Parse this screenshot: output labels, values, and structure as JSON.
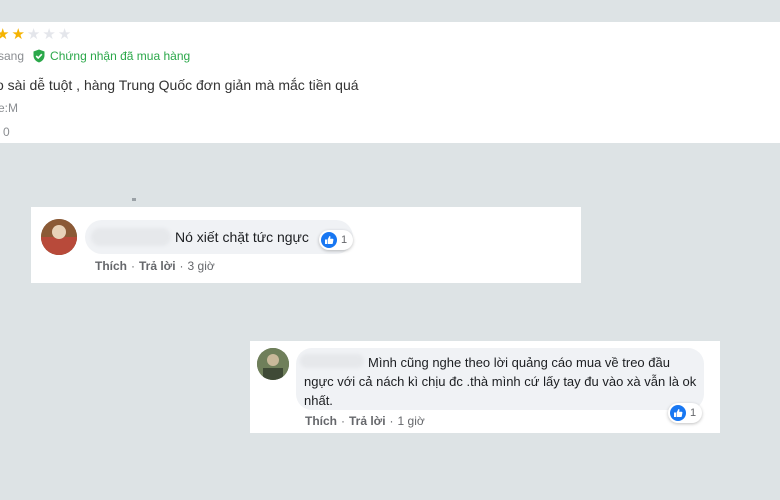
{
  "review": {
    "stars": {
      "filled": 2,
      "total": 5
    },
    "reviewer_partial": "sang",
    "verified_label": "Chứng nhận đã mua hàng",
    "text": "o sài dễ tuột , hàng Trung Quốc đơn giản mà mắc tiền quá",
    "variant": "e:M",
    "likes": "0",
    "colors": {
      "star": "#f5b301",
      "verified": "#2ba84a"
    }
  },
  "comments": [
    {
      "text": "Nó xiết chặt tức ngực",
      "reaction_count": "1",
      "actions": {
        "like": "Thích",
        "reply": "Trả lời",
        "time": "3 giờ"
      }
    },
    {
      "lines": [
        "Mình cũng nghe theo lời quảng cáo mua về treo đầu",
        "ngực với cả nách kì chịu đc .thà mình cứ lấy tay đu vào xà vẫn là ok",
        "nhất."
      ],
      "reaction_count": "1",
      "actions": {
        "like": "Thích",
        "reply": "Trả lời",
        "time": "1 giờ"
      }
    }
  ],
  "icons": [
    "star-icon",
    "verified-shield-icon",
    "like-reaction-icon"
  ],
  "colors": {
    "background": "#dde3e5",
    "like_blue": "#1877f2",
    "bubble": "#f0f2f5"
  }
}
